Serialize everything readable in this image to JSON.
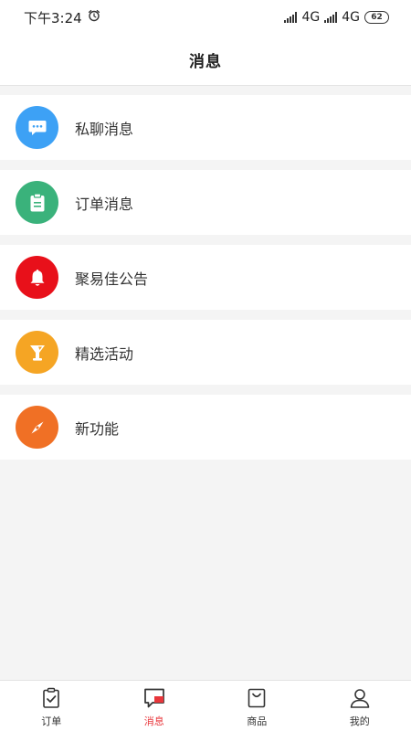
{
  "status_bar": {
    "time": "下午3:24",
    "network1": "4G",
    "network2": "4G",
    "battery": "62",
    "icons": [
      "alarm-icon",
      "signal-icon",
      "signal-icon"
    ]
  },
  "header": {
    "title": "消息"
  },
  "colors": {
    "chat": "#3da1f5",
    "order": "#3ab27b",
    "notice": "#e8101a",
    "activity": "#f5a524",
    "feature": "#f07025",
    "active_tab": "#e8363b"
  },
  "messages": [
    {
      "label": "私聊消息",
      "icon": "chat-bubble-icon"
    },
    {
      "label": "订单消息",
      "icon": "clipboard-icon"
    },
    {
      "label": "聚易佳公告",
      "icon": "bell-icon"
    },
    {
      "label": "精选活动",
      "icon": "trophy-icon"
    },
    {
      "label": "新功能",
      "icon": "compass-icon"
    }
  ],
  "tabbar": {
    "active": "消息",
    "items": [
      {
        "label": "订单",
        "icon": "clipboard-check-icon"
      },
      {
        "label": "消息",
        "icon": "message-icon"
      },
      {
        "label": "商品",
        "icon": "shopping-bag-icon"
      },
      {
        "label": "我的",
        "icon": "person-icon"
      }
    ]
  }
}
